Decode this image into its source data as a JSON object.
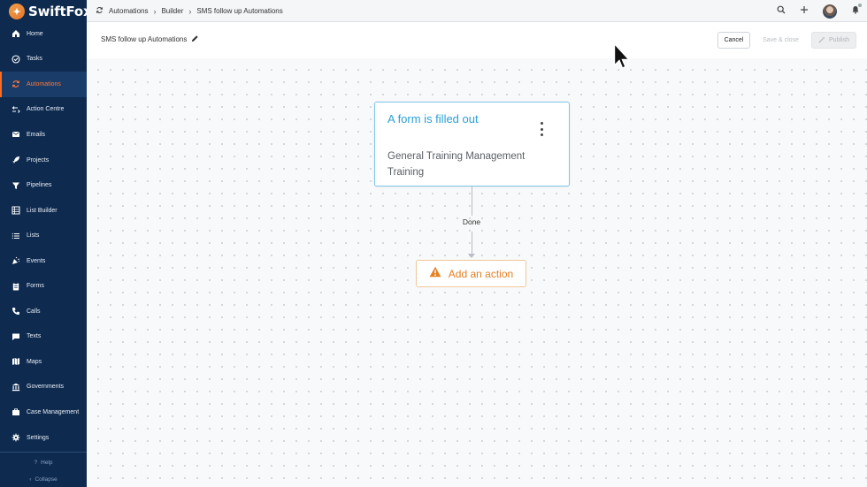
{
  "app": {
    "name": "SwiftFox"
  },
  "breadcrumb": [
    "Automations",
    "Builder",
    "SMS follow up Automations"
  ],
  "sidebar": {
    "items": [
      {
        "label": "Home",
        "icon": "home-icon"
      },
      {
        "label": "Tasks",
        "icon": "check-circle-icon"
      },
      {
        "label": "Automations",
        "icon": "sync-icon",
        "active": true
      },
      {
        "label": "Action Centre",
        "icon": "action-centre-icon"
      },
      {
        "label": "Emails",
        "icon": "mail-icon"
      },
      {
        "label": "Projects",
        "icon": "rocket-icon"
      },
      {
        "label": "Pipelines",
        "icon": "filter-icon"
      },
      {
        "label": "List Builder",
        "icon": "list-builder-icon"
      },
      {
        "label": "Lists",
        "icon": "list-icon"
      },
      {
        "label": "Events",
        "icon": "party-icon"
      },
      {
        "label": "Forms",
        "icon": "clipboard-icon"
      },
      {
        "label": "Calls",
        "icon": "phone-icon"
      },
      {
        "label": "Texts",
        "icon": "chat-icon"
      },
      {
        "label": "Maps",
        "icon": "map-icon"
      },
      {
        "label": "Governments",
        "icon": "bank-icon"
      },
      {
        "label": "Case Management",
        "icon": "briefcase-icon"
      },
      {
        "label": "Settings",
        "icon": "gear-icon"
      }
    ],
    "help_label": "Help",
    "collapse_label": "Collapse"
  },
  "header": {
    "title": "SMS follow up Automations",
    "cancel_label": "Cancel",
    "save_label": "Save & close",
    "publish_label": "Publish"
  },
  "canvas": {
    "trigger": {
      "title": "A form is filled out",
      "subtitle": "General Training Management Training"
    },
    "connector_label": "Done",
    "action": {
      "label": "Add an action"
    }
  },
  "colors": {
    "sidebar_bg": "#0e2a4f",
    "accent_orange": "#ff6a21",
    "trigger_blue": "#2a9fd6",
    "action_orange": "#e57f22"
  }
}
